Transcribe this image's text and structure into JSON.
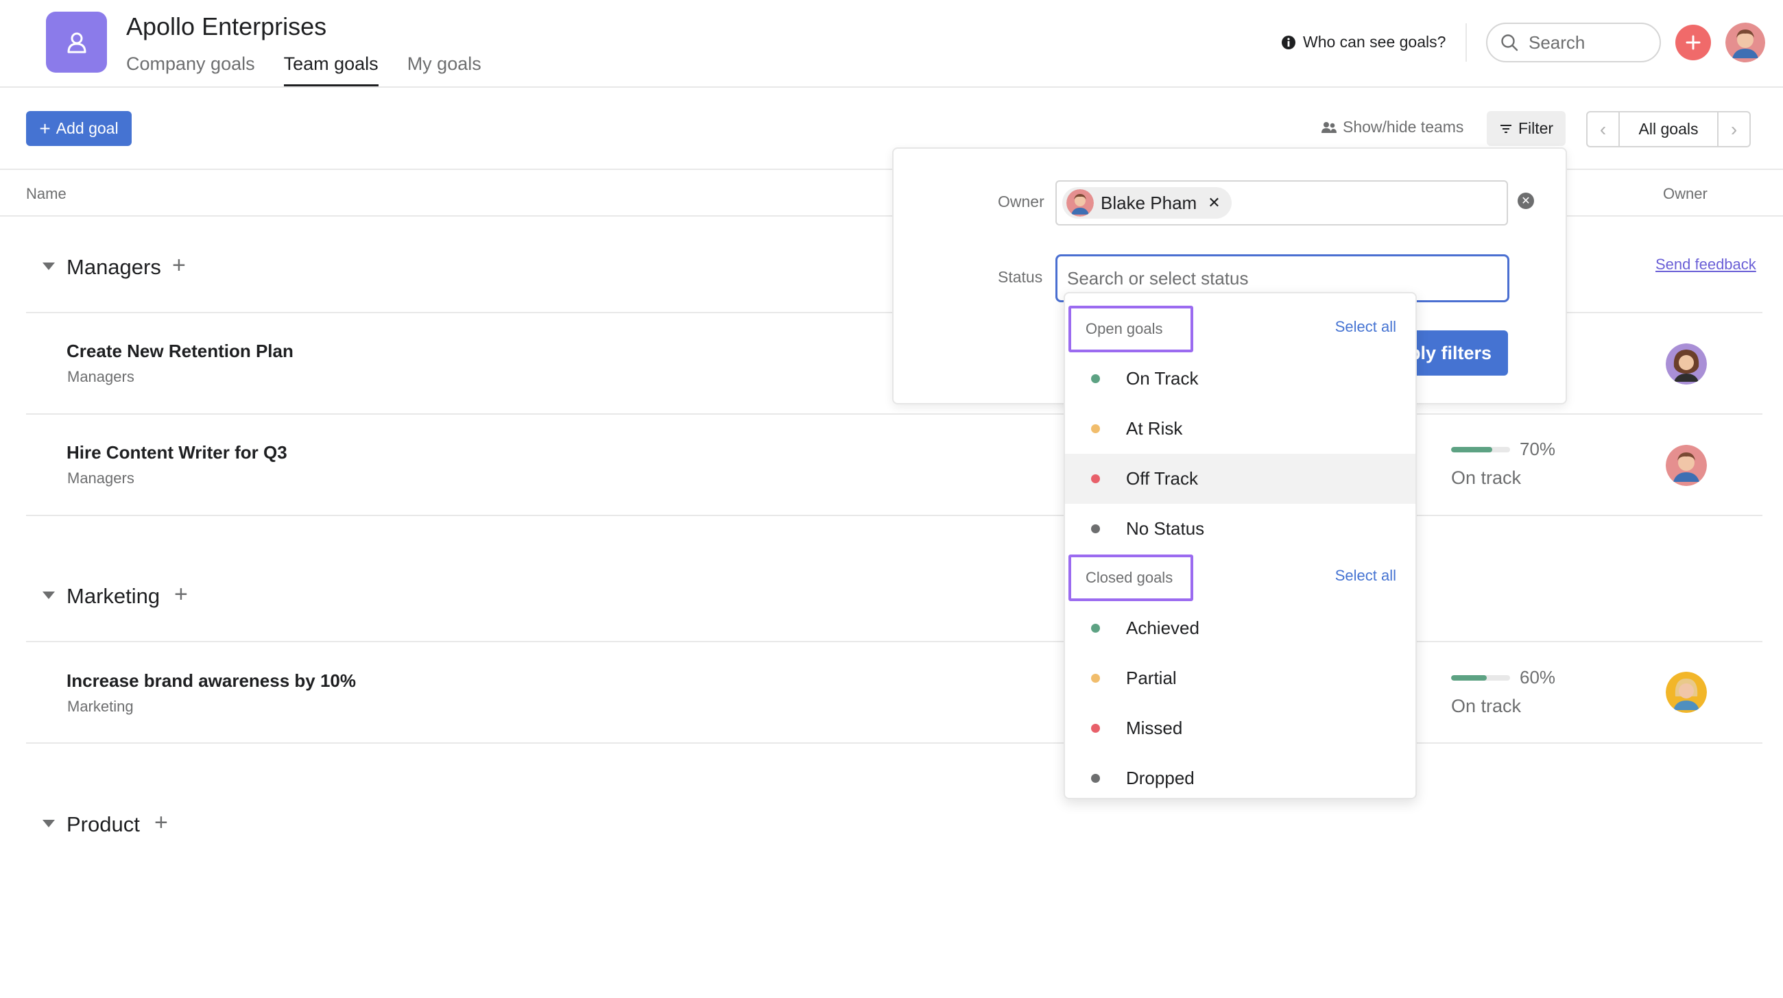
{
  "header": {
    "org_title": "Apollo Enterprises",
    "tabs": [
      {
        "label": "Company goals",
        "active": false
      },
      {
        "label": "Team goals",
        "active": true
      },
      {
        "label": "My goals",
        "active": false
      }
    ],
    "who_can_see": "Who can see goals?",
    "search_placeholder": "Search"
  },
  "toolbar": {
    "add_goal": "Add goal",
    "show_hide_teams": "Show/hide teams",
    "filter": "Filter",
    "view_label": "All goals"
  },
  "columns": {
    "name": "Name",
    "owner": "Owner"
  },
  "send_feedback": "Send feedback",
  "sections": [
    {
      "title": "Managers",
      "goals": [
        {
          "title": "Create New Retention Plan",
          "team": "Managers"
        },
        {
          "title": "Hire Content Writer for Q3",
          "team": "Managers",
          "progress_pct": "70%",
          "progress_value": 0.7,
          "status": "On track"
        }
      ]
    },
    {
      "title": "Marketing",
      "goals": [
        {
          "title": "Increase brand awareness by 10%",
          "team": "Marketing",
          "progress_pct": "60%",
          "progress_value": 0.6,
          "status": "On track"
        }
      ]
    },
    {
      "title": "Product",
      "goals": []
    }
  ],
  "filter_panel": {
    "owner_label": "Owner",
    "owner_chip": "Blake Pham",
    "status_label": "Status",
    "status_placeholder": "Search or select status",
    "apply_label": "ply filters"
  },
  "status_dropdown": {
    "open_group": {
      "label": "Open goals",
      "select_all": "Select all",
      "options": [
        {
          "label": "On Track",
          "color": "#5da283"
        },
        {
          "label": "At Risk",
          "color": "#f1bd6c"
        },
        {
          "label": "Off Track",
          "color": "#e8606a"
        },
        {
          "label": "No Status",
          "color": "#6d6e6f"
        }
      ]
    },
    "closed_group": {
      "label": "Closed goals",
      "select_all": "Select all",
      "options": [
        {
          "label": "Achieved",
          "color": "#5da283"
        },
        {
          "label": "Partial",
          "color": "#f1bd6c"
        },
        {
          "label": "Missed",
          "color": "#e8606a"
        },
        {
          "label": "Dropped",
          "color": "#6d6e6f"
        }
      ]
    }
  },
  "colors": {
    "accent": "#4573d2",
    "logo": "#8b7bea",
    "add_circle": "#f06a6a",
    "highlight_border": "#9b6bf0",
    "progress_fill": "#5da283"
  }
}
